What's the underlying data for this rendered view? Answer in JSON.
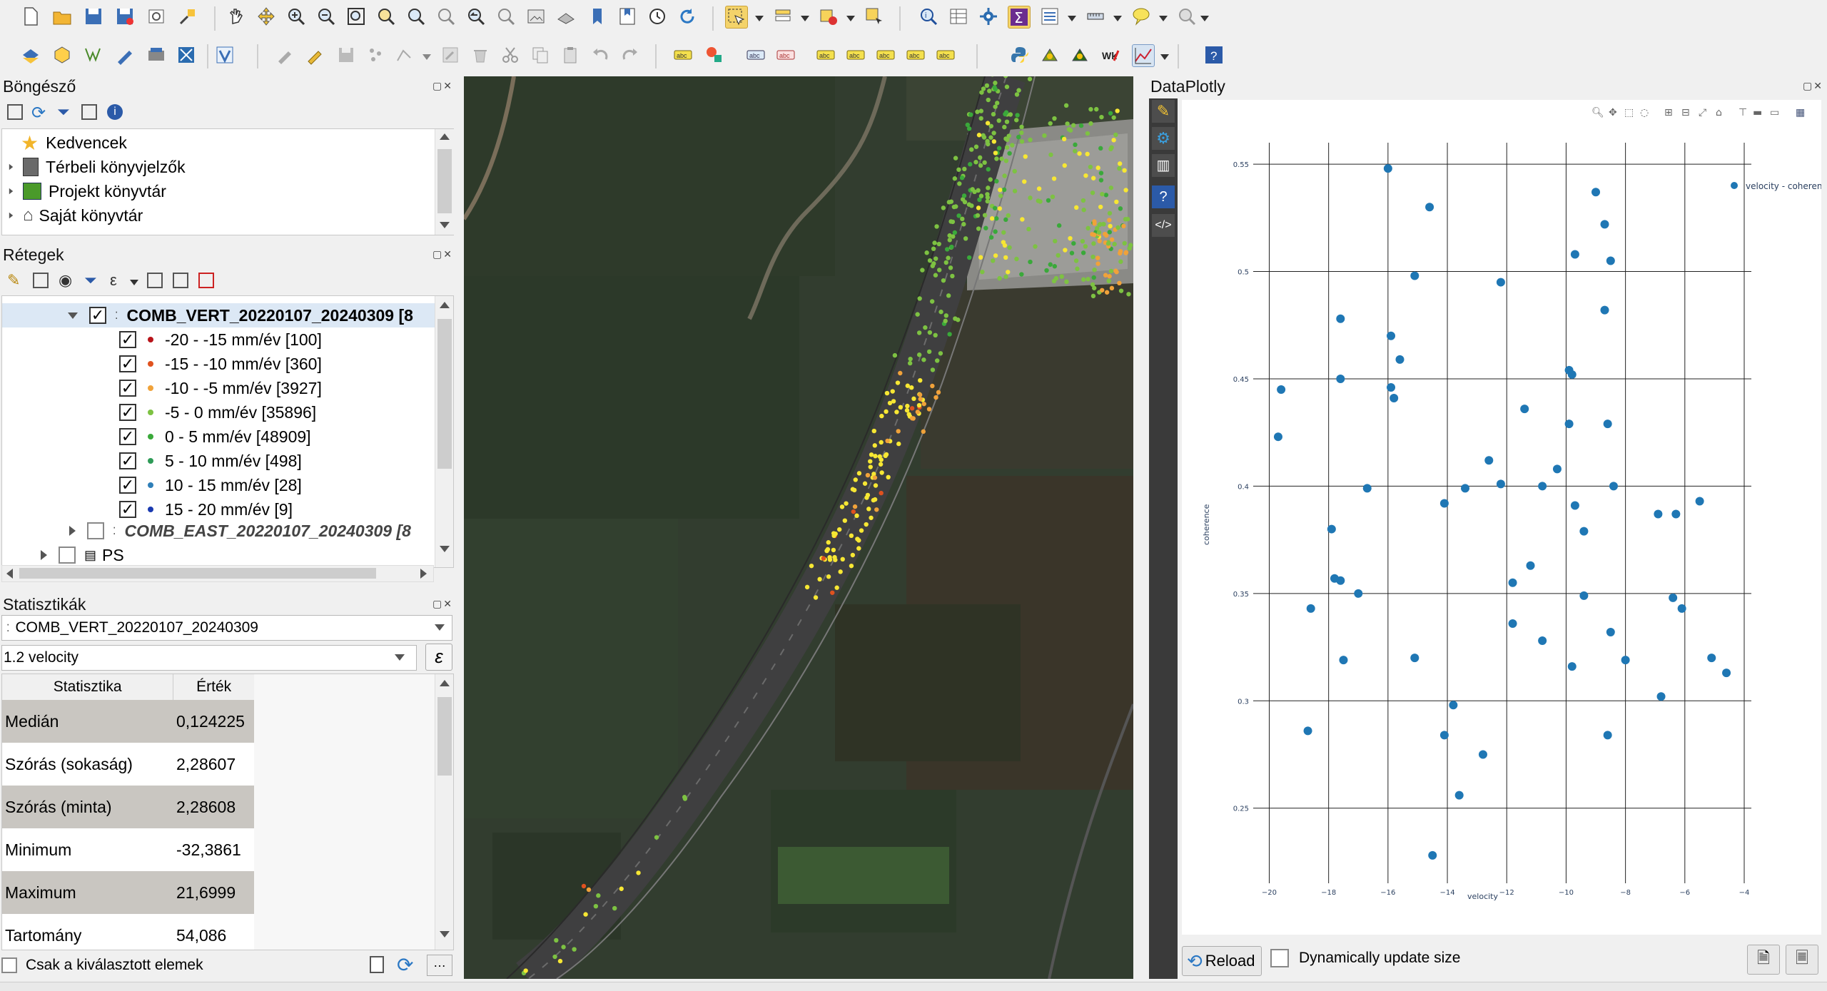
{
  "browser_panel": {
    "title": "Böngésző",
    "items": [
      {
        "label": "Kedvencek"
      },
      {
        "label": "Térbeli könyvjelzők"
      },
      {
        "label": "Projekt könyvtár"
      },
      {
        "label": "Saját könyvtár"
      }
    ]
  },
  "layers_panel": {
    "title": "Rétegek",
    "main_layer": "COMB_VERT_20220107_20240309 [8",
    "classes": [
      {
        "label": "-20 - -15 mm/év [100]",
        "color": "#b8141a"
      },
      {
        "label": "-15 - -10 mm/év [360]",
        "color": "#e0521f"
      },
      {
        "label": "-10 - -5 mm/év [3927]",
        "color": "#f0a23a"
      },
      {
        "label": "-5 - 0 mm/év [35896]",
        "color": "#7dc242"
      },
      {
        "label": "0 - 5 mm/év [48909]",
        "color": "#3aa93a"
      },
      {
        "label": "5 - 10 mm/év [498]",
        "color": "#2e9b57"
      },
      {
        "label": "10 - 15 mm/év [28]",
        "color": "#2f7fb8"
      },
      {
        "label": "15 - 20 mm/év [9]",
        "color": "#1a3ab0"
      }
    ],
    "second_layer": "COMB_EAST_20220107_20240309 [8",
    "third_layer": "PS"
  },
  "stats_panel": {
    "title": "Statisztikák",
    "layer_select": "COMB_VERT_20220107_20240309",
    "field_select": "1.2 velocity",
    "col_stat": "Statisztika",
    "col_value": "Érték",
    "rows": [
      {
        "name": "Medián",
        "value": "0,124225"
      },
      {
        "name": "Szórás (sokaság)",
        "value": "2,28607"
      },
      {
        "name": "Szórás (minta)",
        "value": "2,28608"
      },
      {
        "name": "Minimum",
        "value": "-32,3861"
      },
      {
        "name": "Maximum",
        "value": "21,6999"
      },
      {
        "name": "Tartomány",
        "value": "54,086"
      }
    ],
    "only_selected_label": "Csak a kiválasztott elemek"
  },
  "plotly_panel": {
    "title": "DataPlotly",
    "reload_label": "Reload",
    "dynamic_label": "Dynamically update size"
  },
  "chart_data": {
    "type": "scatter",
    "xlabel": "velocity",
    "ylabel": "coherence",
    "legend": "velocity - coherence",
    "legend_position": "top-right",
    "marker_color": "#1f77b4",
    "xlim": [
      -20.3,
      -4.0
    ],
    "ylim": [
      0.215,
      0.56
    ],
    "xticks": [
      -20,
      -18,
      -16,
      -14,
      -12,
      -10,
      -8,
      -6,
      -4
    ],
    "yticks": [
      0.25,
      0.3,
      0.35,
      0.4,
      0.45,
      0.5,
      0.55
    ],
    "xtick_labels": [
      "−20",
      "−18",
      "−16",
      "−14",
      "−12",
      "−10",
      "−8",
      "−6",
      "−4"
    ],
    "ytick_labels": [
      "0.25",
      "0.3",
      "0.35",
      "0.4",
      "0.45",
      "0.5",
      "0.55"
    ],
    "grid": true,
    "points": [
      [
        -19.6,
        0.445
      ],
      [
        -19.7,
        0.423
      ],
      [
        -18.6,
        0.343
      ],
      [
        -18.7,
        0.286
      ],
      [
        -17.9,
        0.38
      ],
      [
        -17.6,
        0.478
      ],
      [
        -17.6,
        0.45
      ],
      [
        -17.6,
        0.356
      ],
      [
        -17.5,
        0.319
      ],
      [
        -17.0,
        0.35
      ],
      [
        -16.7,
        0.399
      ],
      [
        -16.0,
        0.548
      ],
      [
        -15.9,
        0.47
      ],
      [
        -15.9,
        0.446
      ],
      [
        -15.8,
        0.441
      ],
      [
        -15.6,
        0.459
      ],
      [
        -15.1,
        0.498
      ],
      [
        -15.1,
        0.32
      ],
      [
        -14.6,
        0.53
      ],
      [
        -14.5,
        0.228
      ],
      [
        -14.1,
        0.392
      ],
      [
        -14.1,
        0.284
      ],
      [
        -13.8,
        0.298
      ],
      [
        -13.6,
        0.256
      ],
      [
        -12.8,
        0.275
      ],
      [
        -12.6,
        0.412
      ],
      [
        -12.2,
        0.401
      ],
      [
        -12.2,
        0.495
      ],
      [
        -11.8,
        0.355
      ],
      [
        -11.8,
        0.336
      ],
      [
        -11.4,
        0.436
      ],
      [
        -11.2,
        0.363
      ],
      [
        -10.8,
        0.328
      ],
      [
        -10.8,
        0.4
      ],
      [
        -10.3,
        0.408
      ],
      [
        -9.9,
        0.429
      ],
      [
        -9.9,
        0.454
      ],
      [
        -9.8,
        0.452
      ],
      [
        -9.7,
        0.508
      ],
      [
        -9.7,
        0.391
      ],
      [
        -9.8,
        0.316
      ],
      [
        -9.4,
        0.379
      ],
      [
        -9.4,
        0.349
      ],
      [
        -9.0,
        0.537
      ],
      [
        -8.7,
        0.522
      ],
      [
        -8.5,
        0.505
      ],
      [
        -8.7,
        0.482
      ],
      [
        -8.6,
        0.429
      ],
      [
        -8.4,
        0.4
      ],
      [
        -8.5,
        0.332
      ],
      [
        -8.6,
        0.284
      ],
      [
        -8.0,
        0.319
      ],
      [
        -6.9,
        0.387
      ],
      [
        -6.8,
        0.302
      ],
      [
        -6.3,
        0.387
      ],
      [
        -6.4,
        0.348
      ],
      [
        -6.1,
        0.343
      ],
      [
        -5.5,
        0.393
      ],
      [
        -5.1,
        0.32
      ],
      [
        -4.6,
        0.313
      ],
      [
        -17.8,
        0.357
      ],
      [
        -13.4,
        0.399
      ]
    ]
  }
}
